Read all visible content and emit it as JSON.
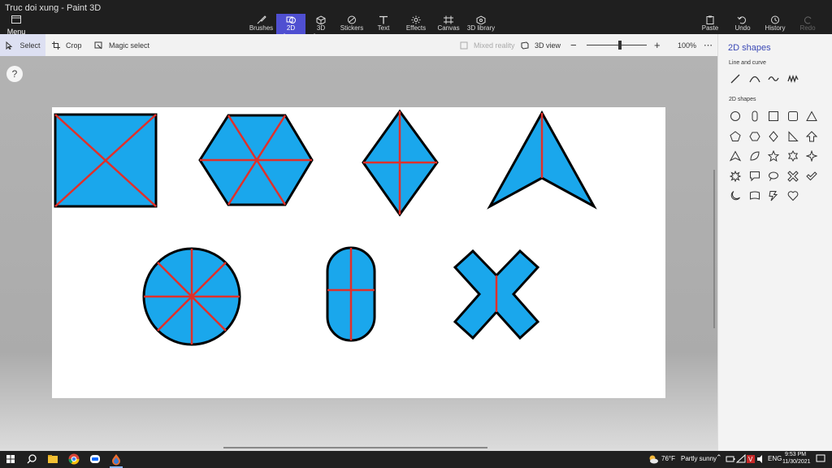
{
  "window": {
    "title": "Truc doi xung - Paint 3D"
  },
  "menu": {
    "label": "Menu"
  },
  "toolbar": {
    "tools": [
      "Brushes",
      "2D shapes",
      "3D shapes",
      "Stickers",
      "Text",
      "Effects",
      "Canvas",
      "3D library"
    ],
    "active": "2D shapes",
    "right": [
      "Paste",
      "Undo",
      "History",
      "Redo"
    ]
  },
  "subtoolbar": {
    "select": "Select",
    "crop": "Crop",
    "magic_select": "Magic select",
    "mixed_reality": "Mixed reality",
    "view_3d": "3D view",
    "zoom": "100%",
    "zoom_level": 0.55
  },
  "help": {
    "label": "?"
  },
  "panel": {
    "title": "2D shapes",
    "line_section": "Line and curve",
    "shapes_section": "2D shapes",
    "line_tools": [
      "line-icon",
      "curve-icon",
      "wave-icon",
      "squiggle-icon"
    ],
    "shape_tools": [
      "circle-icon",
      "capsule-icon",
      "square-icon",
      "rounded-square-icon",
      "triangle-icon",
      "pentagon-icon",
      "hexagon-icon",
      "diamond-icon",
      "right-triangle-icon",
      "arrow-up-icon",
      "arrowhead-icon",
      "leaf-icon",
      "star5-icon",
      "star6-icon",
      "star4-icon",
      "burst-icon",
      "speech-bubble-icon",
      "thought-bubble-icon",
      "cross-icon",
      "check-icon",
      "moon-icon",
      "banner-icon",
      "lightning-icon",
      "heart-icon"
    ]
  },
  "colors": {
    "fill": "#1aa7ec",
    "stroke": "#000000",
    "axis": "#e0302a",
    "accent": "#4f4fd1"
  },
  "taskbar": {
    "weather": "76°F",
    "weather_text": "Partly sunny",
    "lang": "ENG",
    "time": "9:53 PM",
    "date": "11/30/2021"
  }
}
